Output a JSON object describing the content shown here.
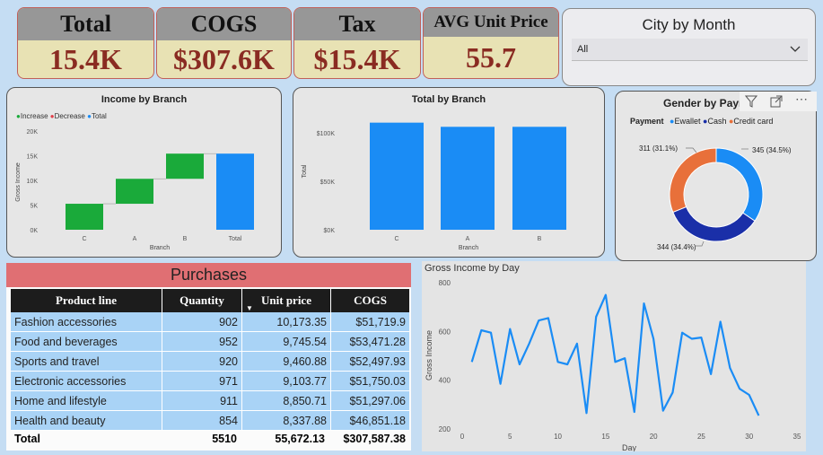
{
  "kpis": {
    "total": {
      "label": "Total",
      "value": "15.4K"
    },
    "cogs": {
      "label": "COGS",
      "value": "$307.6K"
    },
    "tax": {
      "label": "Tax",
      "value": "$15.4K"
    },
    "avg": {
      "label": "AVG Unit Price",
      "value": "55.7"
    }
  },
  "slicer": {
    "title": "City by Month",
    "value": "All"
  },
  "income_branch": {
    "title": "Income by Branch",
    "legend": [
      "Increase",
      "Decrease",
      "Total"
    ],
    "ylabel": "Gross Income",
    "xlabel": "Branch",
    "yticks": [
      "0K",
      "5K",
      "10K",
      "15K",
      "20K"
    ]
  },
  "total_branch": {
    "title": "Total by Branch",
    "ylabel": "Total",
    "xlabel": "Branch",
    "yticks": [
      "$0K",
      "$50K",
      "$100K"
    ]
  },
  "gender_pay": {
    "title": "Gender by Payment",
    "legend_title": "Payment",
    "legend": [
      "Ewallet",
      "Cash",
      "Credit card"
    ],
    "labels": [
      "345 (34.5%)",
      "344 (34.4%)",
      "311 (31.1%)"
    ]
  },
  "purchases": {
    "title": "Purchases",
    "columns": [
      "Product line",
      "Quantity",
      "Unit price",
      "COGS"
    ],
    "rows": [
      [
        "Fashion accessories",
        "902",
        "10,173.35",
        "$51,719.9"
      ],
      [
        "Food and beverages",
        "952",
        "9,745.54",
        "$53,471.28"
      ],
      [
        "Sports and travel",
        "920",
        "9,460.88",
        "$52,497.93"
      ],
      [
        "Electronic accessories",
        "971",
        "9,103.77",
        "$51,750.03"
      ],
      [
        "Home and lifestyle",
        "911",
        "8,850.71",
        "$51,297.06"
      ],
      [
        "Health and beauty",
        "854",
        "8,337.88",
        "$46,851.18"
      ]
    ],
    "total": [
      "Total",
      "5510",
      "55,672.13",
      "$307,587.38"
    ]
  },
  "gross_day": {
    "title": "Gross Income by Day",
    "ylabel": "Gross Income",
    "xlabel": "Day"
  },
  "colors": {
    "increase": "#1aaa3a",
    "decrease": "#e0404a",
    "total": "#1a8cf5",
    "ewallet": "#1a8cf5",
    "cash": "#1a2fa8",
    "credit": "#e8703a",
    "line": "#1a8cf5"
  },
  "chart_data": [
    {
      "type": "bar",
      "title": "Income by Branch",
      "subtype": "waterfall",
      "categories": [
        "C",
        "A",
        "B",
        "Total"
      ],
      "values": [
        5265,
        5057,
        5098,
        15420
      ],
      "ylim": [
        0,
        20000
      ],
      "xlabel": "Branch",
      "ylabel": "Gross Income",
      "legend": "top-left"
    },
    {
      "type": "bar",
      "title": "Total by Branch",
      "categories": [
        "C",
        "A",
        "B"
      ],
      "values": [
        110500,
        106200,
        106200
      ],
      "ylim": [
        0,
        120000
      ],
      "xlabel": "Branch",
      "ylabel": "Total"
    },
    {
      "type": "pie",
      "title": "Gender by Payment",
      "categories": [
        "Ewallet",
        "Cash",
        "Credit card"
      ],
      "values": [
        345,
        344,
        311
      ]
    },
    {
      "type": "line",
      "title": "Gross Income by Day",
      "xlabel": "Day",
      "ylabel": "Gross Income",
      "xlim": [
        0,
        35
      ],
      "ylim": [
        200,
        800
      ],
      "x": [
        1,
        2,
        3,
        4,
        5,
        6,
        7,
        8,
        9,
        10,
        11,
        12,
        13,
        14,
        15,
        16,
        17,
        18,
        19,
        20,
        21,
        22,
        23,
        24,
        25,
        26,
        27,
        28,
        29,
        30,
        31
      ],
      "y": [
        475,
        605,
        595,
        385,
        610,
        465,
        550,
        645,
        655,
        475,
        465,
        550,
        265,
        660,
        750,
        475,
        490,
        270,
        715,
        570,
        275,
        350,
        595,
        570,
        575,
        425,
        640,
        450,
        365,
        340,
        255
      ],
      "xticks": [
        0,
        5,
        10,
        15,
        20,
        25,
        30,
        35
      ],
      "yticks": [
        200,
        400,
        600,
        800
      ]
    }
  ]
}
